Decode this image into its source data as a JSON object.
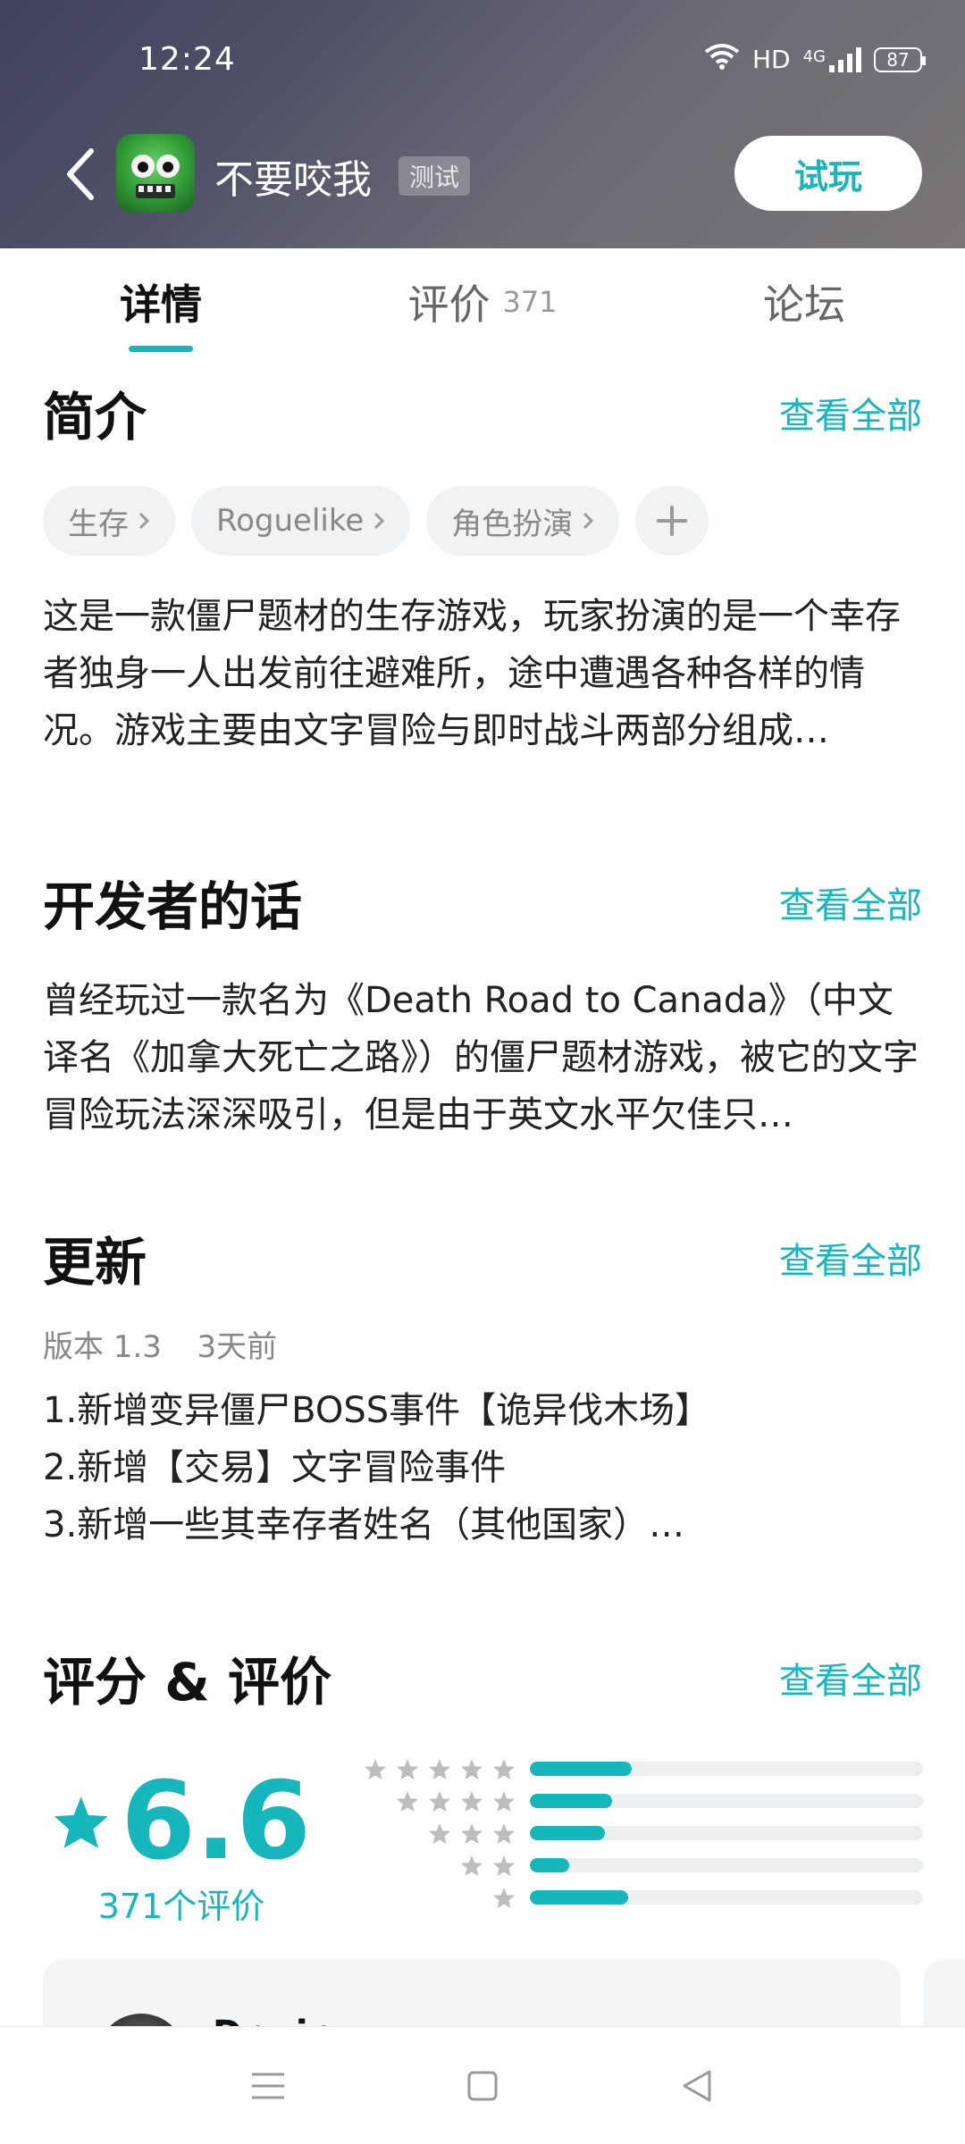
{
  "status": {
    "time": "12:24",
    "network": "HD",
    "signal": "4G",
    "battery": "87"
  },
  "header": {
    "title": "不要咬我",
    "tag": "测试",
    "try_label": "试玩"
  },
  "tabs": [
    {
      "label": "详情",
      "count": ""
    },
    {
      "label": "评价",
      "count": "371"
    },
    {
      "label": "论坛",
      "count": ""
    }
  ],
  "intro": {
    "title": "简介",
    "see_all": "查看全部",
    "tags": [
      "生存",
      "Roguelike",
      "角色扮演"
    ],
    "text": "这是一款僵尸题材的生存游戏，玩家扮演的是一个幸存者独身一人出发前往避难所，途中遭遇各种各样的情况。游戏主要由文字冒险与即时战斗两部分组成…"
  },
  "dev": {
    "title": "开发者的话",
    "see_all": "查看全部",
    "text": "曾经玩过一款名为《Death Road to Canada》（中文译名《加拿大死亡之路》）的僵尸题材游戏，被它的文字冒险玩法深深吸引，但是由于英文水平欠佳只…"
  },
  "update": {
    "title": "更新",
    "see_all": "查看全部",
    "version": "版本 1.3",
    "ago": "3天前",
    "items": [
      "1.新增变异僵尸BOSS事件【诡异伐木场】",
      "2.新增【交易】文字冒险事件",
      "3.新增一些其幸存者姓名（其他国家）…"
    ]
  },
  "rating": {
    "title": "评分 & 评价",
    "see_all": "查看全部",
    "score": "6.6",
    "count_label": "371个评价",
    "distribution": [
      {
        "stars": 5,
        "fraction": 0.26
      },
      {
        "stars": 4,
        "fraction": 0.21
      },
      {
        "stars": 3,
        "fraction": 0.19
      },
      {
        "stars": 2,
        "fraction": 0.1
      },
      {
        "stars": 1,
        "fraction": 0.25
      }
    ]
  },
  "review": {
    "user": "Dr…in"
  },
  "colors": {
    "accent": "#16b6bd",
    "star_gray": "#bdbdbd"
  }
}
